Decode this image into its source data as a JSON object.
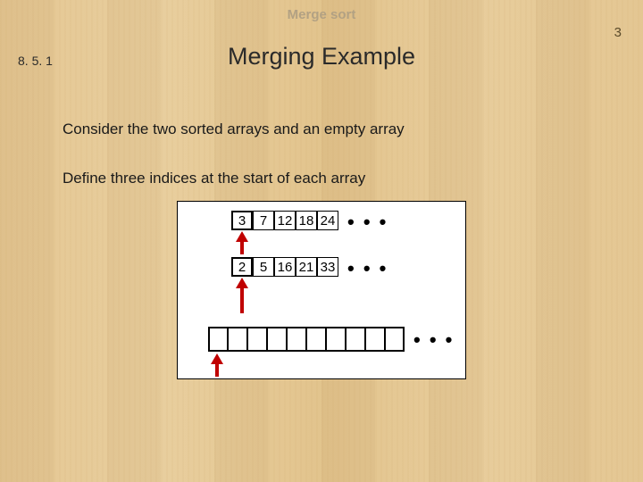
{
  "header": {
    "top_title": "Merge sort",
    "page_number": "3",
    "section_number": "8. 5. 1",
    "main_title": "Merging Example"
  },
  "body": {
    "paragraph1": "Consider the two sorted arrays and an empty array",
    "paragraph2": "Define three indices at the start of each array"
  },
  "diagram": {
    "array1": [
      "3",
      "7",
      "12",
      "18",
      "24"
    ],
    "array2": [
      "2",
      "5",
      "16",
      "21",
      "33"
    ],
    "array3_cells": 10,
    "dots": "• • •"
  }
}
